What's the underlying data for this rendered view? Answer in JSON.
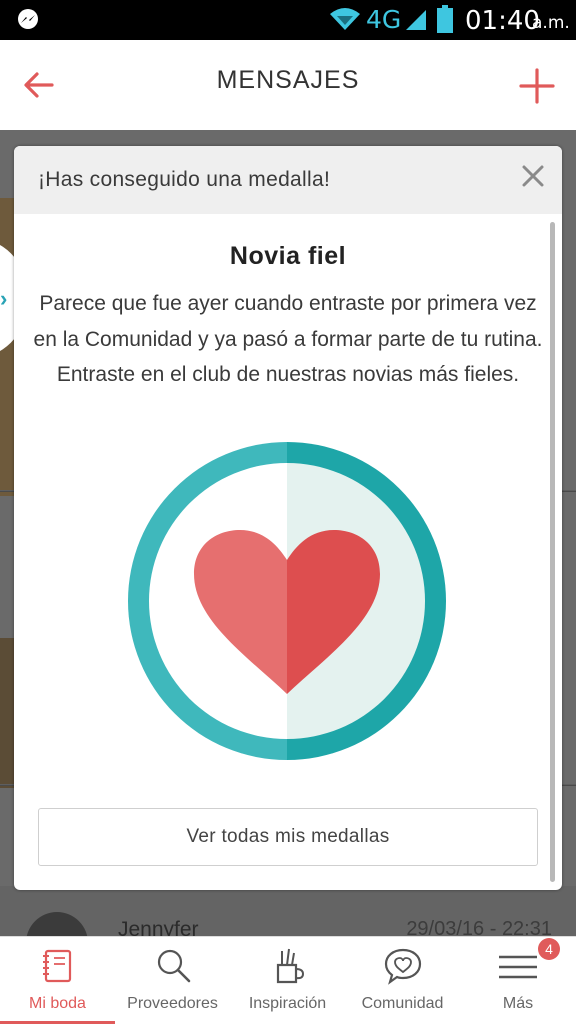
{
  "status_bar": {
    "network": "4G",
    "time": "01:40",
    "ampm": "a.m."
  },
  "app_bar": {
    "title": "MENSAJES"
  },
  "background": {
    "item_name": "Jennyfer",
    "item_date": "29/03/16 - 22:31"
  },
  "modal": {
    "header_title": "¡Has conseguido una medalla!",
    "medal_name": "Novia fiel",
    "medal_description": "Parece que fue ayer cuando entraste por primera vez en la Comunidad y ya pasó a formar parte de tu rutina. Entraste en el club de nuestras novias más fieles.",
    "button_label": "Ver todas mis medallas"
  },
  "bottom_nav": {
    "items": [
      {
        "label": "Mi boda",
        "icon": "notebook-icon",
        "active": true
      },
      {
        "label": "Proveedores",
        "icon": "search-icon"
      },
      {
        "label": "Inspiración",
        "icon": "pencil-cup-icon"
      },
      {
        "label": "Comunidad",
        "icon": "heart-chat-icon"
      },
      {
        "label": "Más",
        "icon": "menu-icon"
      }
    ],
    "badge_count": "4"
  },
  "colors": {
    "accent": "#e05a5a",
    "teal": "#23a8ad",
    "heart_light": "#e66f6f",
    "heart_dark": "#dd4e4f"
  }
}
